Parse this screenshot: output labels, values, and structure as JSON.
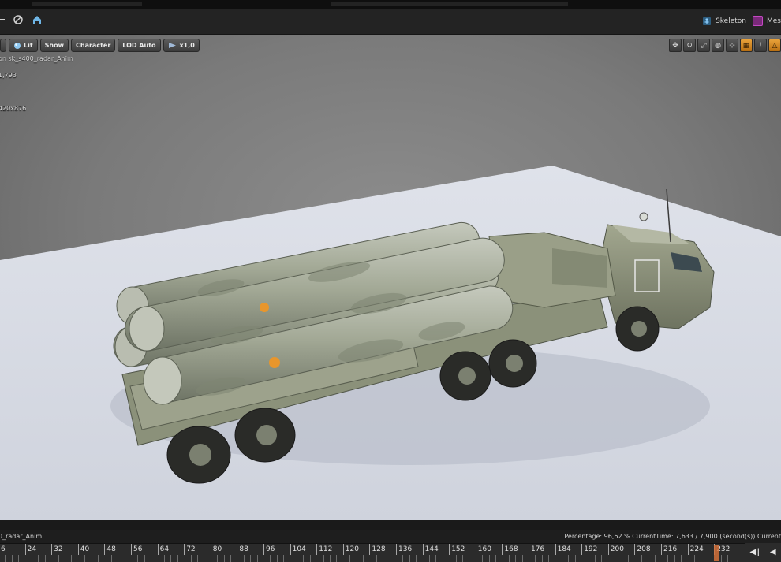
{
  "toolbar": {
    "skeleton_label": "Skeleton",
    "mesh_label": "Mes"
  },
  "viewport": {
    "buttons": {
      "lit": "Lit",
      "show": "Show",
      "character": "Character",
      "lod": "LOD Auto",
      "speed": "x1,0"
    },
    "overlay": {
      "anim_name": "on sk_s400_radar_Anim",
      "value": "1,793",
      "resolution": "420x876"
    }
  },
  "status_bar": {
    "anim_name": "0_radar_Anim",
    "playback_info": "Percentage: 96,62 % CurrentTime: 7,633 / 7,900 (second(s)) Current"
  },
  "timeline": {
    "frames": [
      "6",
      "24",
      "32",
      "40",
      "48",
      "56",
      "64",
      "72",
      "80",
      "88",
      "96",
      "104",
      "112",
      "120",
      "128",
      "136",
      "144",
      "152",
      "160",
      "168",
      "176",
      "184",
      "192",
      "200",
      "208",
      "216",
      "224",
      "232"
    ]
  },
  "colors": {
    "accent_orange": "#e9a23a",
    "skeleton_icon": "#5fa8d9",
    "mesh_icon": "#c448c4"
  },
  "icons": {
    "skeleton": "skeleton-icon",
    "mesh": "mesh-icon",
    "lit": "lit-sphere-icon",
    "speed": "play-speed-icon"
  }
}
